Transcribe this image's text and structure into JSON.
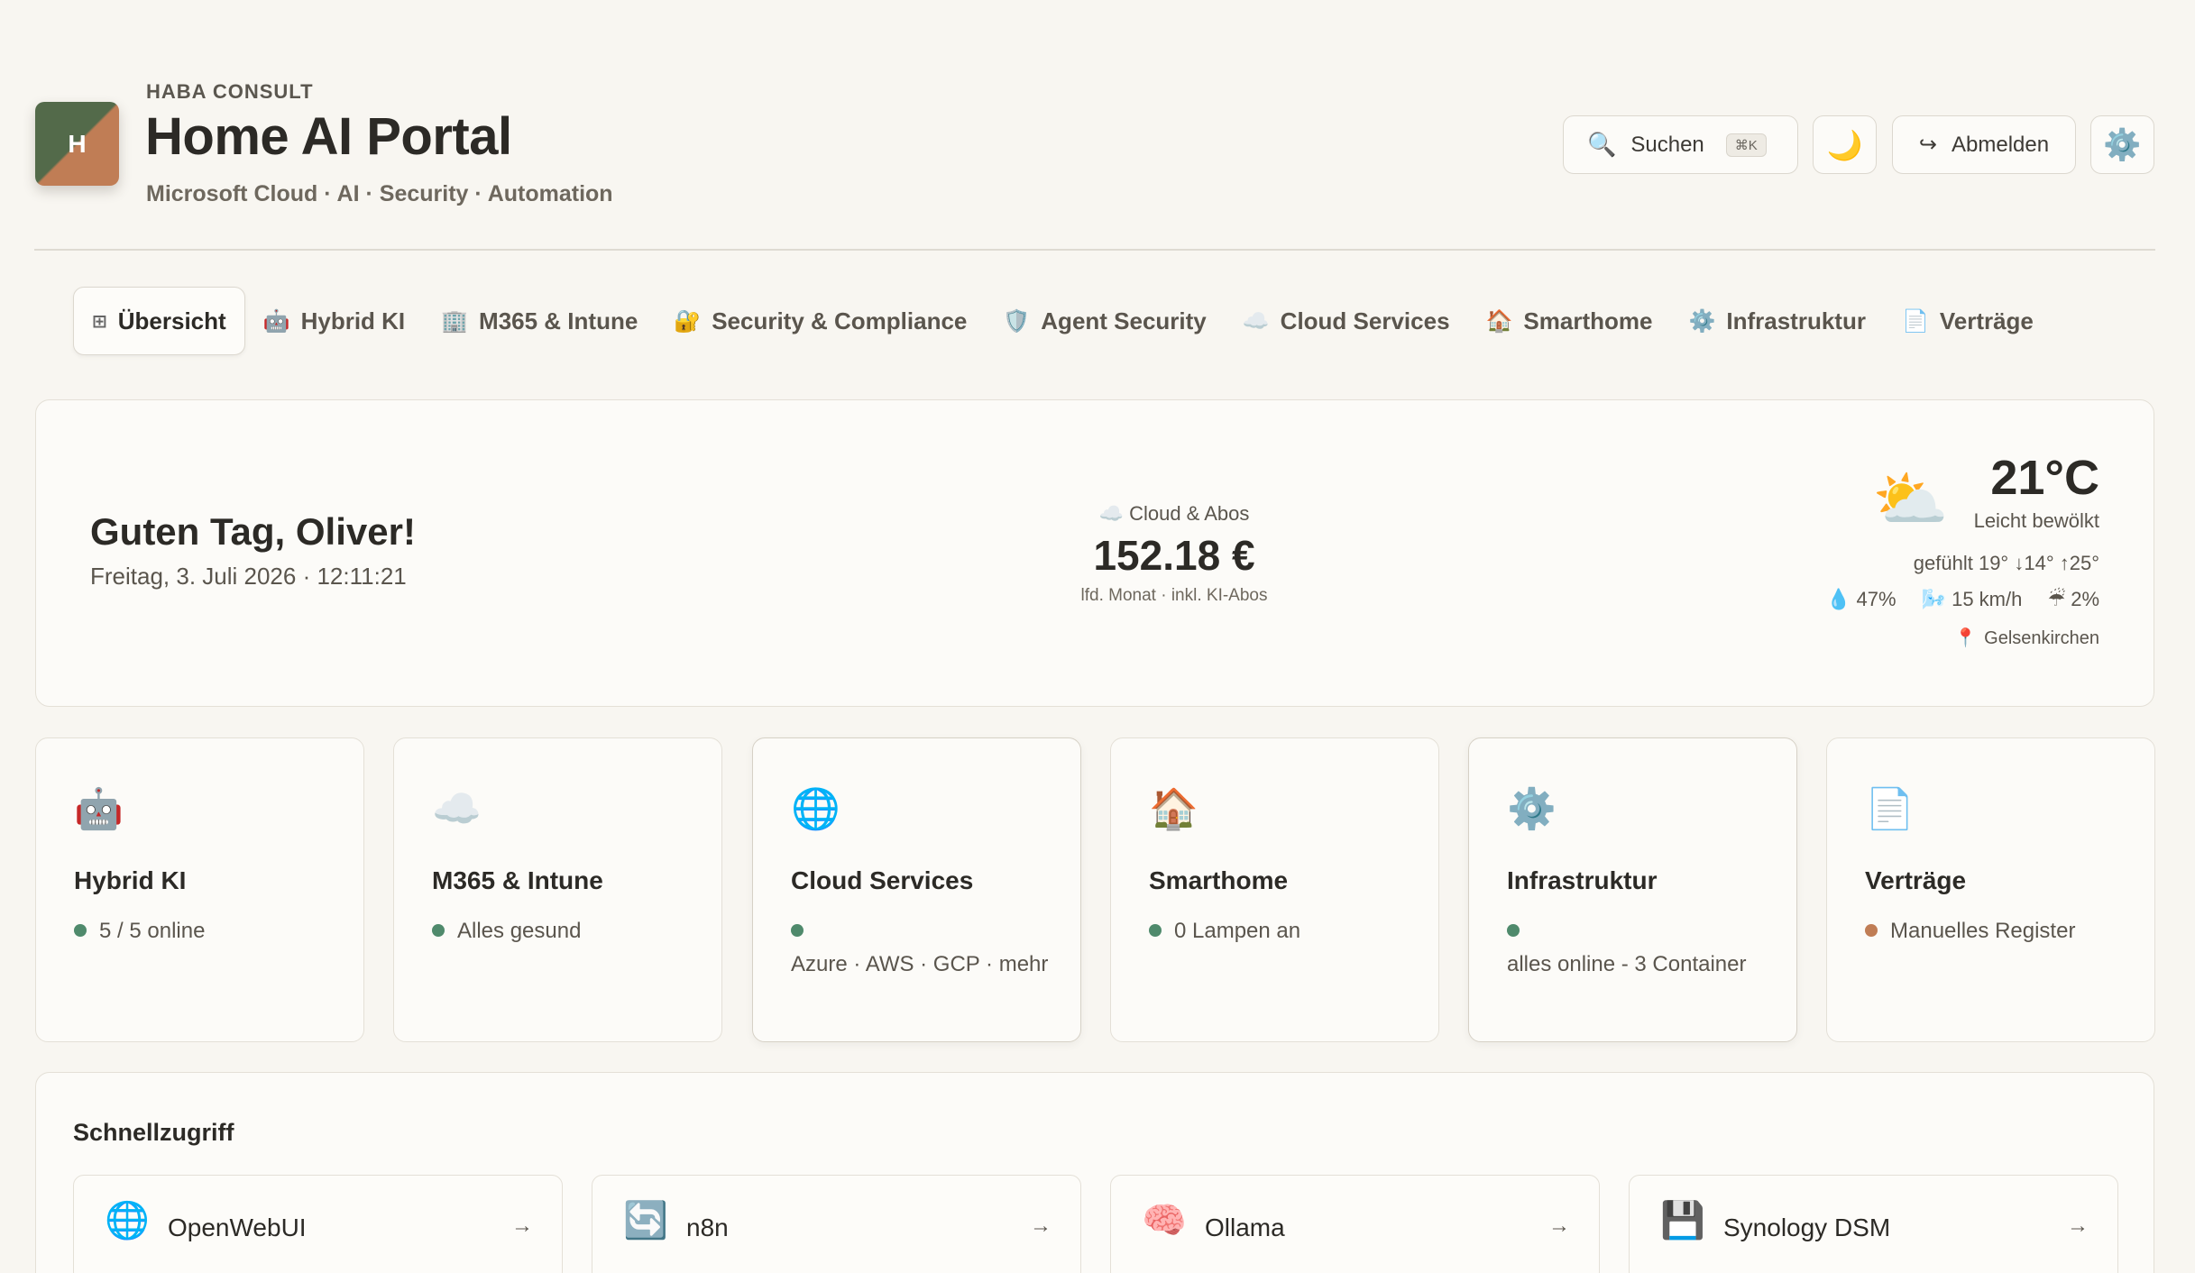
{
  "header": {
    "logo_letter": "H",
    "eyebrow": "HABA CONSULT",
    "title": "Home AI Portal",
    "subtitle": "Microsoft Cloud · AI · Security · Automation",
    "search_label": "Suchen",
    "search_shortcut": "⌘K",
    "theme_icon": "moon-icon",
    "logout_label": "Abmelden",
    "settings_icon": "gear-icon"
  },
  "tabs": [
    {
      "icon": "⊞",
      "label": "Übersicht",
      "active": true
    },
    {
      "icon": "🤖",
      "label": "Hybrid KI"
    },
    {
      "icon": "🏢",
      "label": "M365 & Intune"
    },
    {
      "icon": "🔐",
      "label": "Security & Compliance"
    },
    {
      "icon": "🛡️",
      "label": "Agent Security"
    },
    {
      "icon": "☁️",
      "label": "Cloud Services"
    },
    {
      "icon": "🏠",
      "label": "Smarthome"
    },
    {
      "icon": "⚙️",
      "label": "Infrastruktur"
    },
    {
      "icon": "📄",
      "label": "Verträge"
    }
  ],
  "hero": {
    "greeting": "Guten Tag, Oliver!",
    "date": "Freitag, 3. Juli 2026 · 12:11:21",
    "cost_label": "☁️ Cloud & Abos",
    "cost_value": "152.18 €",
    "cost_sub": "lfd. Monat · inkl. KI-Abos",
    "weather": {
      "icon": "sun-behind-cloud-icon",
      "temp": "21°C",
      "condition": "Leicht bewölkt",
      "feels": "gefühlt 19°  ↓14°  ↑25°",
      "humidity": "47%",
      "wind": "15 km/h",
      "rain": "2%",
      "location": "Gelsenkirchen"
    }
  },
  "cards": [
    {
      "icon": "🤖",
      "title": "Hybrid KI",
      "status": "5 / 5 online",
      "dot": "green"
    },
    {
      "icon": "☁️",
      "title": "M365 & Intune",
      "status": "Alles gesund",
      "dot": "green"
    },
    {
      "icon": "🌐",
      "title": "Cloud Services",
      "status": "Azure · AWS · GCP · mehr",
      "dot": "green"
    },
    {
      "icon": "🏠",
      "title": "Smarthome",
      "status": "0 Lampen an",
      "dot": "green"
    },
    {
      "icon": "⚙️",
      "title": "Infrastruktur",
      "status": "alles online - 3 Container",
      "dot": "green"
    },
    {
      "icon": "📄",
      "title": "Verträge",
      "status": "Manuelles Register",
      "dot": "orange"
    }
  ],
  "quick": {
    "title": "Schnellzugriff",
    "items": [
      {
        "icon": "🌐",
        "label": "OpenWebUI"
      },
      {
        "icon": "🔄",
        "label": "n8n"
      },
      {
        "icon": "🧠",
        "label": "Ollama"
      },
      {
        "icon": "💾",
        "label": "Synology DSM"
      }
    ],
    "arrow": "→"
  },
  "colors": {
    "background": "#f8f6f1",
    "status_green": "#4f8a6c",
    "status_orange": "#c07d55",
    "logo_green": "#536a4a",
    "logo_terracotta": "#c07d55"
  }
}
